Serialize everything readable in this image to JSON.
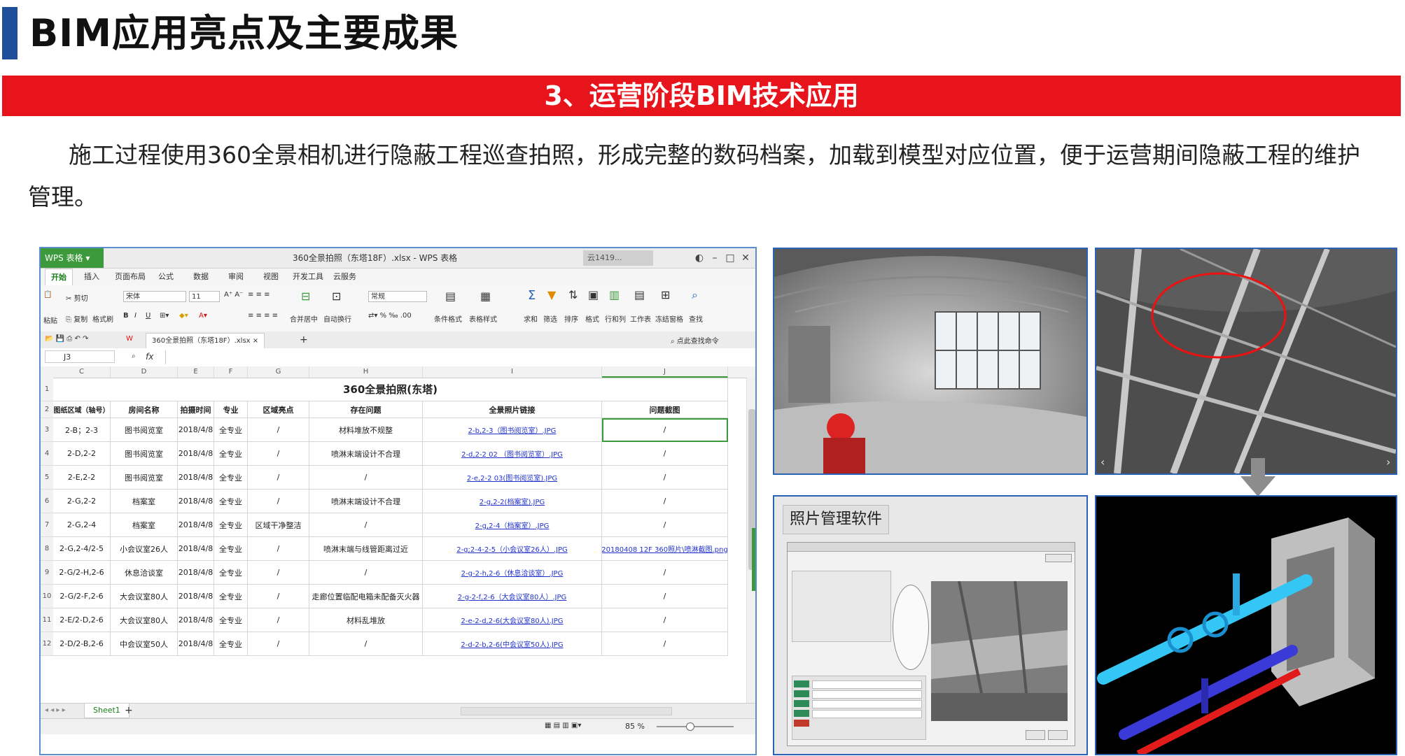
{
  "slide": {
    "title": "BIM应用亮点及主要成果",
    "section": "3、运营阶段BIM技术应用",
    "paragraph": "施工过程使用360全景相机进行隐蔽工程巡查拍照，形成完整的数码档案，加载到模型对应位置，便于运营期间隐蔽工程的维护管理。"
  },
  "colors": {
    "accent_blue": "#1f4e9a",
    "banner_red": "#e8141c",
    "wps_green": "#3c9a3c"
  },
  "wps": {
    "app_label": "WPS 表格",
    "window_title": "360全景拍照（东塔18F）.xlsx - WPS 表格",
    "cloud_label": "云1419...",
    "menus": [
      "开始",
      "插入",
      "页面布局",
      "公式",
      "数据",
      "审阅",
      "视图",
      "开发工具",
      "云服务"
    ],
    "ribbon": {
      "cut": "剪切",
      "copy": "复制",
      "format_painter": "格式刷",
      "paste": "粘贴",
      "font": "宋体",
      "font_size": "11",
      "merge": "合并居中",
      "wrap": "自动换行",
      "number_format": "常规",
      "cond_format": "条件格式",
      "table_style": "表格样式",
      "sum": "求和",
      "filter": "筛选",
      "sort": "排序",
      "format": "格式",
      "rowcol": "行和列",
      "sheet": "工作表",
      "freeze": "冻结窗格",
      "find": "查找",
      "search_cmd": "点此查找命令"
    },
    "doc_tab": "360全景拍照（东塔18F）.xlsx",
    "cell_ref": "J3",
    "fx": "fx",
    "col_heads": [
      "C",
      "D",
      "E",
      "F",
      "G",
      "H",
      "I",
      "J"
    ],
    "sheet_title": "360全景拍照(东塔)",
    "table_headers": [
      "图纸区域（轴号）",
      "房间名称",
      "拍摄时间",
      "专业",
      "区域亮点",
      "存在问题",
      "全景照片链接",
      "问题截图"
    ],
    "rows": [
      [
        "2-B；2-3",
        "图书阅览室",
        "2018/4/8",
        "全专业",
        "/",
        "材料堆放不规整",
        "2-b,2-3（图书阅览室）.JPG",
        "/"
      ],
      [
        "2-D,2-2",
        "图书阅览室",
        "2018/4/8",
        "全专业",
        "/",
        "喷淋末端设计不合理",
        "2-d,2-2 02 （图书阅览室）.JPG",
        "/"
      ],
      [
        "2-E,2-2",
        "图书阅览室",
        "2018/4/8",
        "全专业",
        "/",
        "/",
        "2-e,2-2 03(图书阅览室).JPG",
        "/"
      ],
      [
        "2-G,2-2",
        "档案室",
        "2018/4/8",
        "全专业",
        "/",
        "喷淋末端设计不合理",
        "2-g,2-2(档案室).JPG",
        "/"
      ],
      [
        "2-G,2-4",
        "档案室",
        "2018/4/8",
        "全专业",
        "区域干净整洁",
        "/",
        "2-g,2-4（档案室）.JPG",
        "/"
      ],
      [
        "2-G,2-4/2-5",
        "小会议室26人",
        "2018/4/8",
        "全专业",
        "/",
        "喷淋末端与线管距离过近",
        "2-g;2-4-2-5（小会议室26人）.JPG",
        "20180408 12F 360照片\\喷淋截图.png"
      ],
      [
        "2-G/2-H,2-6",
        "休息洽谈室",
        "2018/4/8",
        "全专业",
        "/",
        "/",
        "2-g-2-h,2-6（休息洽谈室）.JPG",
        "/"
      ],
      [
        "2-G/2-F,2-6",
        "大会议室80人",
        "2018/4/8",
        "全专业",
        "/",
        "走廊位置临配电箱未配备灭火器",
        "2-g-2-f,2-6（大会议室80人）.JPG",
        "/"
      ],
      [
        "2-E/2-D,2-6",
        "大会议室80人",
        "2018/4/8",
        "全专业",
        "/",
        "材料乱堆放",
        "2-e-2-d,2-6(大会议室80人).JPG",
        "/"
      ],
      [
        "2-D/2-B,2-6",
        "中会议室50人",
        "2018/4/8",
        "全专业",
        "/",
        "/",
        "2-d-2-b,2-6(中会议室50人).JPG",
        "/"
      ]
    ],
    "sheet_tab": "Sheet1",
    "zoom": "85 %"
  },
  "photo_software": {
    "label": "照片管理软件"
  }
}
